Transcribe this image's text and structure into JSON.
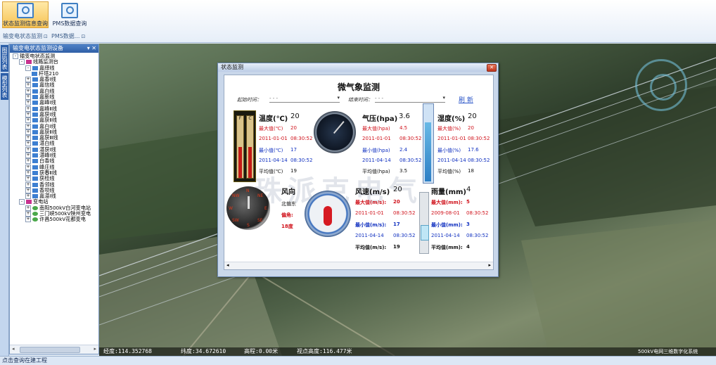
{
  "ribbon": {
    "btn1_label": "状态监测信息查询",
    "btn2_label": "PMS数据查询",
    "group1": "输变电状态监测",
    "group2": "PMS数据..."
  },
  "side_tabs": [
    "图层列表",
    "模型列表"
  ],
  "tree_panel": {
    "title": "输变电状态监测设备",
    "pin_icons": "▾ ✕",
    "nodes": [
      {
        "label": "输变电状态监测",
        "level": 0,
        "icon": "",
        "exp": "-"
      },
      {
        "label": "线路监测台",
        "level": 1,
        "icon": "pink",
        "exp": "-"
      },
      {
        "label": "嘉绎线",
        "level": 2,
        "icon": "blue",
        "exp": "-"
      },
      {
        "label": "杆塔210",
        "level": 3,
        "icon": "blue",
        "exp": ""
      },
      {
        "label": "嘉香Ⅰ线",
        "level": 2,
        "icon": "blue",
        "exp": "+"
      },
      {
        "label": "嘉信线",
        "level": 2,
        "icon": "blue",
        "exp": "+"
      },
      {
        "label": "嘉白线",
        "level": 2,
        "icon": "blue",
        "exp": "+"
      },
      {
        "label": "嘉新线",
        "level": 2,
        "icon": "blue",
        "exp": "+"
      },
      {
        "label": "嘉峰Ⅰ线",
        "level": 2,
        "icon": "blue",
        "exp": "+"
      },
      {
        "label": "嘉峰Ⅱ线",
        "level": 2,
        "icon": "blue",
        "exp": "+"
      },
      {
        "label": "嘉获Ⅰ线",
        "level": 2,
        "icon": "blue",
        "exp": "+"
      },
      {
        "label": "嘉获Ⅱ线",
        "level": 2,
        "icon": "blue",
        "exp": "+"
      },
      {
        "label": "嘉白Ⅰ线",
        "level": 2,
        "icon": "blue",
        "exp": "+"
      },
      {
        "label": "嘉获Ⅱ线",
        "level": 2,
        "icon": "blue",
        "exp": "+"
      },
      {
        "label": "嘉获Ⅲ线",
        "level": 2,
        "icon": "blue",
        "exp": "+"
      },
      {
        "label": "湛白线",
        "level": 2,
        "icon": "blue",
        "exp": "+"
      },
      {
        "label": "湛获Ⅰ线",
        "level": 2,
        "icon": "blue",
        "exp": "+"
      },
      {
        "label": "湛峰Ⅰ线",
        "level": 2,
        "icon": "blue",
        "exp": "+"
      },
      {
        "label": "白香线",
        "level": 2,
        "icon": "blue",
        "exp": "+"
      },
      {
        "label": "峰庄线",
        "level": 2,
        "icon": "blue",
        "exp": "+"
      },
      {
        "label": "获春Ⅱ线",
        "level": 2,
        "icon": "blue",
        "exp": "+"
      },
      {
        "label": "获桂线",
        "level": 2,
        "icon": "blue",
        "exp": "+"
      },
      {
        "label": "香邻线",
        "level": 2,
        "icon": "blue",
        "exp": "+"
      },
      {
        "label": "香坝线",
        "level": 2,
        "icon": "blue",
        "exp": "+"
      },
      {
        "label": "嘉湛Ⅰ线",
        "level": 2,
        "icon": "blue",
        "exp": "+"
      },
      {
        "label": "变电站",
        "level": 1,
        "icon": "pink",
        "exp": "-"
      },
      {
        "label": "南阳500kV白河变电站",
        "level": 2,
        "icon": "green",
        "exp": "+"
      },
      {
        "label": "三门峡500kV陕州变电",
        "level": 2,
        "icon": "green",
        "exp": "+"
      },
      {
        "label": "许昌500kV花都变电",
        "level": 2,
        "icon": "green",
        "exp": "+"
      }
    ]
  },
  "map_status": {
    "lon": "经度:114.352768",
    "lat": "纬度:34.672610",
    "alt": "高程:0.00米",
    "view_alt": "视点高度:116.477米",
    "right_text": "500kV电网三维数字化系统"
  },
  "bottom_status": "点击查询在建工程",
  "dialog": {
    "title": "状态监测",
    "close_glyph": "✕",
    "main_title": "微气象监测",
    "start_label": "起始时间：",
    "end_label": "结束时间：",
    "start_value": "- - -",
    "end_value": "- - -",
    "refresh": "刷 新",
    "watermark": "珠派克电气",
    "temperature": {
      "header": "温度(℃)",
      "value": "20",
      "max_label": "最大值(℃)",
      "max": "20",
      "max_date": "2011-01-01",
      "max_time": "08:30:52",
      "min_label": "最小值(℃)",
      "min": "17",
      "min_date": "2011-04-14",
      "min_time": "08:30:52",
      "avg_label": "平均值(℃)",
      "avg": "19",
      "therm_left": "F",
      "therm_right": "C"
    },
    "pressure": {
      "header": "气压(hpa)",
      "value": "3.6",
      "max_label": "最大值(hpa)",
      "max": "4.5",
      "max_date": "2011-01-01",
      "max_time": "08:30:52",
      "min_label": "最小值(hpa)",
      "min": "2.4",
      "min_date": "2011-04-14",
      "min_time": "08:30:52",
      "avg_label": "平均值(hpa)",
      "avg": "3.5"
    },
    "humidity": {
      "header": "湿度(%)",
      "value": "20",
      "max_label": "最大值(%)",
      "max": "20",
      "max_date": "2011-01-01",
      "max_time": "08:30:52",
      "min_label": "最小值(%)",
      "min": "17.6",
      "min_date": "2011-04-14",
      "min_time": "08:30:52",
      "avg_label": "平均值(%)",
      "avg": "18",
      "level": 0.75
    },
    "wind_dir": {
      "header": "风向",
      "direction": "北偏东",
      "angle_label": "偏角:",
      "angle": "18度",
      "compass": [
        "N",
        "S",
        "E",
        "W",
        "NE",
        "NW",
        "SE",
        "SW"
      ]
    },
    "wind_speed": {
      "header": "风速(m/s)",
      "value": "20",
      "max_label": "最大值(m/s):",
      "max": "20",
      "max_date": "2011-01-01",
      "max_time": "08:30:52",
      "min_label": "最小值(m/s):",
      "min": "17",
      "min_date": "2011-04-14",
      "min_time": "08:30:52",
      "avg_label": "平均值(m/s):",
      "avg": "19"
    },
    "rain": {
      "header": "雨量(mm)",
      "value": "4",
      "max_label": "最大值(mm):",
      "max": "5",
      "max_date": "2009-08-01",
      "max_time": "08:30:52",
      "min_label": "最小值(mm):",
      "min": "3",
      "min_date": "2011-04-14",
      "min_time": "08:30:52",
      "avg_label": "平均值(mm):",
      "avg": "4"
    },
    "scroll_left": "◂",
    "scroll_right": "▸"
  }
}
